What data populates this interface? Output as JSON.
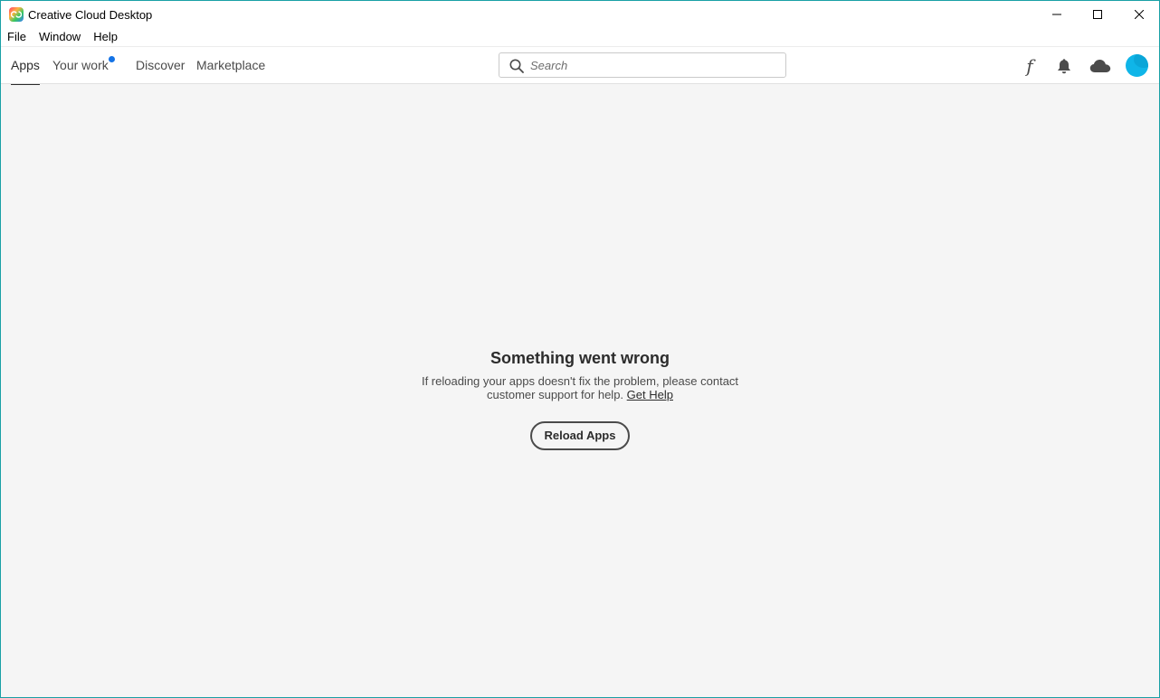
{
  "window": {
    "title": "Creative Cloud Desktop",
    "border_color": "#1aa0a6"
  },
  "menubar": {
    "items": [
      {
        "label": "File"
      },
      {
        "label": "Window"
      },
      {
        "label": "Help"
      }
    ]
  },
  "nav": {
    "tabs": [
      {
        "label": "Apps",
        "active": true
      },
      {
        "label": "Your work",
        "has_notification": true
      },
      {
        "label": "Discover"
      },
      {
        "label": "Marketplace"
      }
    ],
    "search": {
      "placeholder": "Search",
      "value": ""
    },
    "icons": [
      "fonts-icon",
      "bell-icon",
      "cloud-icon",
      "avatar"
    ],
    "fonts_glyph": "f",
    "accent_color": "#1473e6"
  },
  "error": {
    "title": "Something went wrong",
    "description": "If reloading your apps doesn't fix the problem, please contact customer support for help.",
    "link_label": "Get Help",
    "button_label": "Reload Apps"
  }
}
